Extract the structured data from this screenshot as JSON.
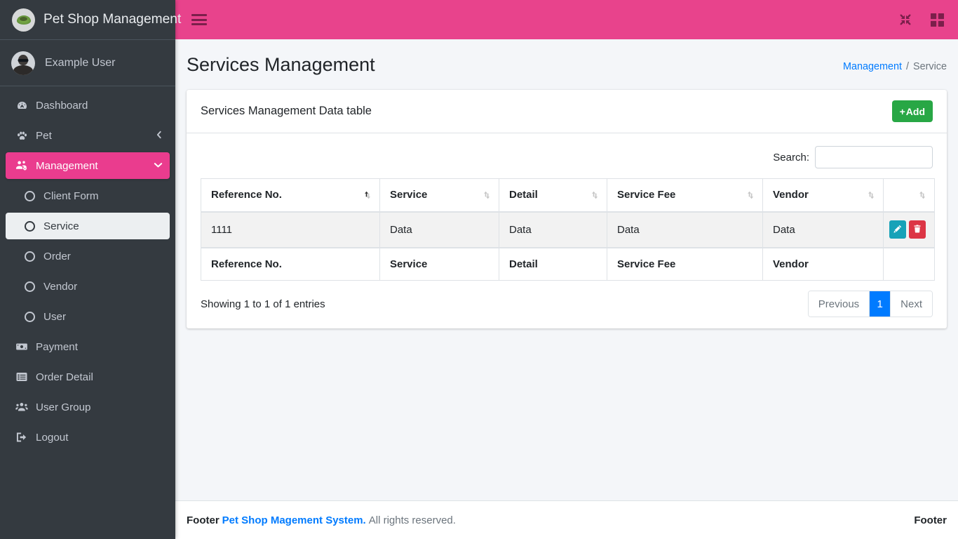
{
  "brand": {
    "title": "Pet Shop Management",
    "logo_icon": "paw-leaf-logo-icon"
  },
  "user_panel": {
    "name": "Example User",
    "avatar_icon": "avatar"
  },
  "topbar": {
    "menu_icon": "hamburger-icon",
    "compress_icon": "compress-arrows-icon",
    "grid_icon": "grid-apps-icon"
  },
  "sidebar": {
    "items": [
      {
        "label": "Dashboard",
        "icon": "tachometer-icon",
        "type": "link",
        "state": "normal"
      },
      {
        "label": "Pet",
        "icon": "paw-icon",
        "type": "parent",
        "state": "normal",
        "arrow": "chevron-left-icon"
      },
      {
        "label": "Management",
        "icon": "users-cog-icon",
        "type": "parent",
        "state": "active",
        "arrow": "chevron-down-icon"
      },
      {
        "label": "Client Form",
        "icon": "circle-icon",
        "type": "sub",
        "state": "normal"
      },
      {
        "label": "Service",
        "icon": "circle-icon",
        "type": "sub",
        "state": "sub-active"
      },
      {
        "label": "Order",
        "icon": "circle-icon",
        "type": "sub",
        "state": "normal"
      },
      {
        "label": "Vendor",
        "icon": "circle-icon",
        "type": "sub",
        "state": "normal"
      },
      {
        "label": "User",
        "icon": "circle-icon",
        "type": "sub",
        "state": "normal"
      },
      {
        "label": "Payment",
        "icon": "money-bill-icon",
        "type": "link",
        "state": "normal"
      },
      {
        "label": "Order Detail",
        "icon": "list-alt-icon",
        "type": "link",
        "state": "normal"
      },
      {
        "label": "User Group",
        "icon": "users-icon",
        "type": "link",
        "state": "normal"
      },
      {
        "label": "Logout",
        "icon": "sign-out-icon",
        "type": "link",
        "state": "normal"
      }
    ]
  },
  "page": {
    "title": "Services Management",
    "breadcrumb": {
      "parent": "Management",
      "separator": "/",
      "current": "Service"
    }
  },
  "card": {
    "title": "Services Management Data table",
    "add_button": {
      "plus": "+",
      "label": "Add"
    }
  },
  "datatable": {
    "search_label": "Search:",
    "search_value": "",
    "search_placeholder": "",
    "columns": [
      {
        "label": "Reference No.",
        "sort": "asc",
        "sort_icon": "sort-asc-icon"
      },
      {
        "label": "Service",
        "sort": "none",
        "sort_icon": "sort-icon"
      },
      {
        "label": "Detail",
        "sort": "none",
        "sort_icon": "sort-icon"
      },
      {
        "label": "Service Fee",
        "sort": "none",
        "sort_icon": "sort-icon"
      },
      {
        "label": "Vendor",
        "sort": "none",
        "sort_icon": "sort-icon"
      },
      {
        "label": "",
        "sort": "none",
        "sort_icon": "sort-icon"
      }
    ],
    "rows": [
      {
        "reference_no": "1111",
        "service": "Data",
        "detail": "Data",
        "service_fee": "Data",
        "vendor": "Data",
        "actions": {
          "edit_icon": "pencil-icon",
          "delete_icon": "trash-icon"
        }
      }
    ],
    "footer_columns": [
      "Reference No.",
      "Service",
      "Detail",
      "Service Fee",
      "Vendor",
      ""
    ],
    "entries_info": "Showing 1 to 1 of 1 entries",
    "pagination": {
      "previous": "Previous",
      "pages": [
        "1"
      ],
      "current_page": "1",
      "next": "Next"
    }
  },
  "footer": {
    "prefix": "Footer",
    "link": "Pet Shop Magement System.",
    "rights": "All rights reserved.",
    "right_label": "Footer"
  },
  "colors": {
    "accent_pink": "#e8438c",
    "sidebar_dark": "#343a40",
    "add_green": "#28a745",
    "edit_teal": "#17a2b8",
    "delete_red": "#dc3545",
    "page_blue": "#007bff",
    "content_bg": "#f4f6f9"
  }
}
